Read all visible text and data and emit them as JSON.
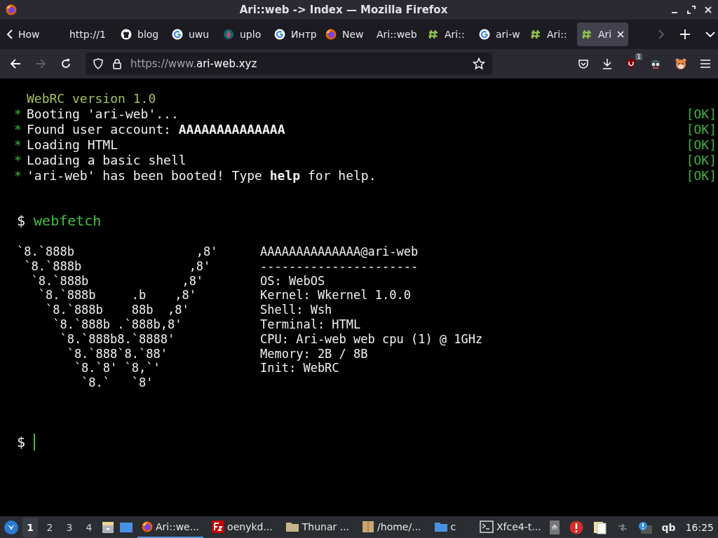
{
  "window": {
    "title": "Ari::web -> Index — Mozilla Firefox"
  },
  "tabs": [
    {
      "label": "How",
      "selected": false
    },
    {
      "label": "http://1",
      "selected": false
    },
    {
      "label": "blog",
      "selected": false
    },
    {
      "label": "uwu",
      "selected": false
    },
    {
      "label": "uplo",
      "selected": false
    },
    {
      "label": "Интр",
      "selected": false
    },
    {
      "label": "New",
      "selected": false
    },
    {
      "label": "Ari::web",
      "selected": false
    },
    {
      "label": "Ari::",
      "selected": false
    },
    {
      "label": "ari-w",
      "selected": false
    },
    {
      "label": "Ari::",
      "selected": false
    },
    {
      "label": "Ari",
      "selected": true
    }
  ],
  "toolbar": {
    "forward_disabled": true,
    "url_prefix": "https://www.",
    "url_domain": "ari-web.xyz",
    "extension_badge": "1"
  },
  "terminal": {
    "header": "WebRC version 1.0",
    "boot_lines": [
      {
        "bullet": "*",
        "text": "Booting 'ari-web'...",
        "status": "[OK]"
      },
      {
        "bullet": "*",
        "text": "Found user account: **AAAAAAAAAAAAAA**",
        "status": "[OK]"
      },
      {
        "bullet": "*",
        "text": "Loading HTML",
        "status": "[OK]"
      },
      {
        "bullet": "*",
        "text": "Loading a basic shell",
        "status": "[OK]"
      },
      {
        "bullet": "*",
        "text": "'ari-web' has been booted! Type **help** for help.",
        "status": "[OK]"
      }
    ],
    "command": {
      "prompt": "$",
      "text": "webfetch"
    },
    "art_lines": [
      "`8.`888b                 ,8'",
      " `8.`888b               ,8'",
      "  `8.`888b             ,8'",
      "   `8.`888b     .b    ,8'",
      "    `8.`888b    88b  ,8'",
      "     `8.`888b .`888b,8'",
      "      `8.`888b8.`8888'",
      "       `8.`888`8.`88'",
      "        `8.`8' `8,`'",
      "         `8.`   `8'"
    ],
    "info_lines": [
      "AAAAAAAAAAAAAA@ari-web",
      "----------------------",
      "OS: WebOS",
      "Kernel: Wkernel 1.0.0",
      "Shell: Wsh",
      "Terminal: HTML",
      "CPU: Ari-web web cpu (1) @ 1GHz",
      "Memory: 2B / 8B",
      "Init: WebRC"
    ],
    "input_prompt": "$"
  },
  "taskbar": {
    "workspaces": [
      {
        "label": "1",
        "selected": true
      },
      {
        "label": "2",
        "selected": false
      },
      {
        "label": "3",
        "selected": false
      },
      {
        "label": "4",
        "selected": false
      }
    ],
    "tasks": [
      {
        "label": "Ari::we...",
        "selected": true
      },
      {
        "label": "oenykd...",
        "selected": false
      },
      {
        "label": "Thunar ...",
        "selected": false
      },
      {
        "label": "/home/...",
        "selected": false
      },
      {
        "label": "c",
        "selected": false
      },
      {
        "label": "Xfce4-t...",
        "selected": false
      }
    ],
    "tray_label": "qb",
    "clock": "16:25"
  }
}
